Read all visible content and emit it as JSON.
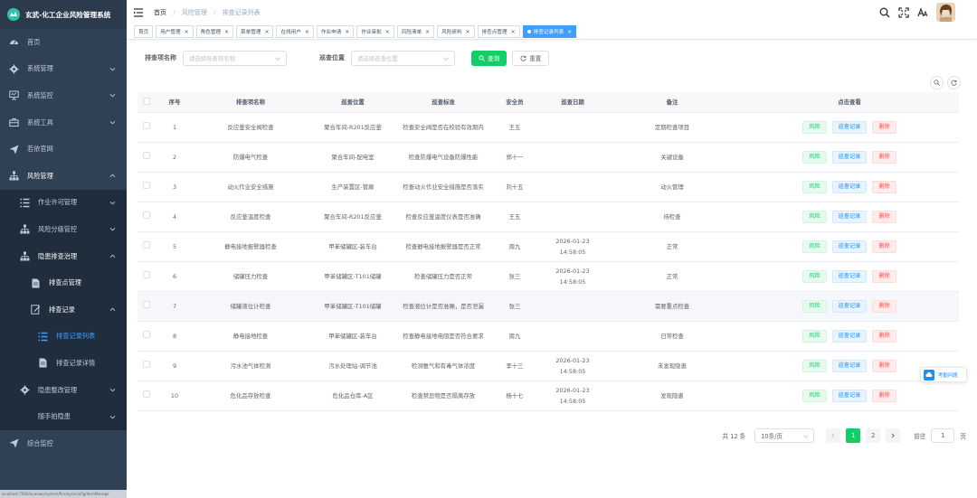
{
  "app_title": "玄武-化工企业风险管理系统",
  "sidebar": {
    "items": [
      {
        "label": "首页",
        "icon": "dashboard-icon",
        "level": 1,
        "chevron": false
      },
      {
        "label": "系统管理",
        "icon": "gear-icon",
        "level": 1,
        "chevron": true
      },
      {
        "label": "系统监控",
        "icon": "monitor-icon",
        "level": 1,
        "chevron": true
      },
      {
        "label": "系统工具",
        "icon": "toolbox-icon",
        "level": 1,
        "chevron": true
      },
      {
        "label": "若依官网",
        "icon": "send-icon",
        "level": 1,
        "chevron": false
      },
      {
        "label": "风险管理",
        "icon": "tree-icon",
        "level": 1,
        "chevron": true,
        "open": true
      },
      {
        "label": "作业许可管理",
        "icon": "list-icon",
        "level": 2,
        "chevron": true
      },
      {
        "label": "风险分级管控",
        "icon": "tree-icon",
        "level": 2,
        "chevron": true
      },
      {
        "label": "隐患排查治理",
        "icon": "tree-icon",
        "level": 2,
        "chevron": true,
        "open": true
      },
      {
        "label": "排查点管理",
        "icon": "doc-icon",
        "level": 3,
        "chevron": false
      },
      {
        "label": "排查记录",
        "icon": "edit-icon",
        "level": 3,
        "chevron": true,
        "open": true
      },
      {
        "label": "排查记录列表",
        "icon": "list-icon",
        "level": 4,
        "chevron": false,
        "active": true
      },
      {
        "label": "排查记录详情",
        "icon": "doc-icon",
        "level": 4,
        "chevron": false
      },
      {
        "label": "隐患整改管理",
        "icon": "gear-icon",
        "level": 2,
        "chevron": true
      },
      {
        "label": "随手拍隐患",
        "icon": "none",
        "level": 2,
        "chevron": true
      },
      {
        "label": "综合监控",
        "icon": "send-icon",
        "level": 1,
        "chevron": false
      }
    ],
    "footer_url": "localhost:7000/xuanwu/system/flcx/sys/config/itemManage"
  },
  "breadcrumb": [
    "首页",
    "风险管理",
    "排查记录列表"
  ],
  "tags": [
    {
      "label": "首页",
      "closable": false
    },
    {
      "label": "用户管理",
      "closable": true
    },
    {
      "label": "角色管理",
      "closable": true
    },
    {
      "label": "菜单管理",
      "closable": true
    },
    {
      "label": "在线用户",
      "closable": true
    },
    {
      "label": "作业申请",
      "closable": true
    },
    {
      "label": "作业审批",
      "closable": true
    },
    {
      "label": "风险清单",
      "closable": true
    },
    {
      "label": "风险研判",
      "closable": true
    },
    {
      "label": "排查点管理",
      "closable": true
    },
    {
      "label": "排查记录列表",
      "closable": true,
      "active": true
    }
  ],
  "search": {
    "item_label": "排查项名称",
    "item_placeholder": "请选择排查项名称",
    "pos_label": "巡查位置",
    "pos_placeholder": "请选择巡查位置",
    "search_btn": "查询",
    "reset_btn": "重置"
  },
  "table": {
    "headers": [
      "序号",
      "排查项名称",
      "巡查位置",
      "巡查标准",
      "安全员",
      "巡查日期",
      "备注",
      "点击查看"
    ],
    "rows": [
      {
        "no": "1",
        "name": "反应釜安全阀检查",
        "pos": "聚合车间-R201反应釜",
        "std": "检查安全阀是否在校验有效期内",
        "officer": "王五",
        "date": "",
        "remark": "定期检查项目"
      },
      {
        "no": "2",
        "name": "防爆电气检查",
        "pos": "聚合车间-配电室",
        "std": "检查防爆电气设备防爆性能",
        "officer": "郑十一",
        "date": "",
        "remark": "关键设备"
      },
      {
        "no": "3",
        "name": "动火作业安全措施",
        "pos": "生产装置区-管廊",
        "std": "检查动火作业安全措施是否落实",
        "officer": "刘十五",
        "date": "",
        "remark": "动火管理"
      },
      {
        "no": "4",
        "name": "反应釜温度检查",
        "pos": "聚合车间-R201反应釜",
        "std": "检查反应釜温度仪表是否准确",
        "officer": "王五",
        "date": "",
        "remark": "待检查"
      },
      {
        "no": "5",
        "name": "静电接地报警器检查",
        "pos": "甲苯储罐区-装车台",
        "std": "检查静电接地报警器是否正常",
        "officer": "周九",
        "date": "2026-01-23 14:58:05",
        "remark": "正常"
      },
      {
        "no": "6",
        "name": "储罐压力检查",
        "pos": "甲苯储罐区-T101储罐",
        "std": "检查储罐压力是否正常",
        "officer": "张三",
        "date": "2026-01-23 14:58:05",
        "remark": "正常"
      },
      {
        "no": "7",
        "name": "储罐液位计检查",
        "pos": "甲苯储罐区-T101储罐",
        "std": "检查液位计是否准确，是否泄漏",
        "officer": "张三",
        "date": "",
        "remark": "需要重点检查"
      },
      {
        "no": "8",
        "name": "静电接地检查",
        "pos": "甲苯储罐区-装车台",
        "std": "检查静电接地电阻是否符合要求",
        "officer": "周九",
        "date": "",
        "remark": "日常检查"
      },
      {
        "no": "9",
        "name": "污水池气体检测",
        "pos": "污水处理站-调节池",
        "std": "检测氨气和有毒气体浓度",
        "officer": "李十三",
        "date": "2026-01-23 14:58:05",
        "remark": "未发现隐患"
      },
      {
        "no": "10",
        "name": "危化品存放检查",
        "pos": "危化品仓库-A区",
        "std": "检查禁忌物是否隔离存放",
        "officer": "杨十七",
        "date": "2026-01-23 14:58:05",
        "remark": "发现隐患"
      }
    ],
    "ops": {
      "risk": "风险",
      "record": "巡查记录",
      "delete": "删除"
    }
  },
  "pagination": {
    "total_text": "共 12 条",
    "page_size": "10条/页",
    "pages": [
      "1",
      "2"
    ],
    "current": "1",
    "goto_label": "前往",
    "goto_value": "1",
    "page_unit": "页"
  },
  "float_help": "考勤问题",
  "colors": {
    "sidebar": "#304156",
    "accent": "#409eff",
    "primary_green": "#13ce66",
    "danger": "#ff4949"
  }
}
